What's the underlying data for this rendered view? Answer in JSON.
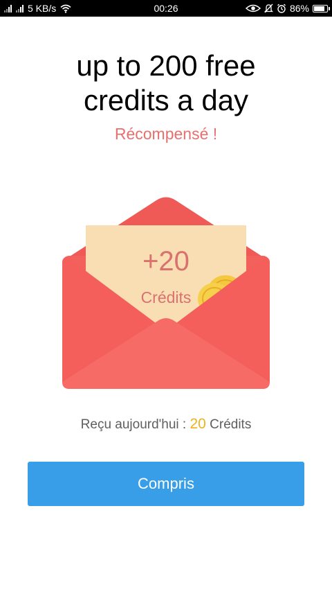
{
  "status_bar": {
    "speed": "5 KB/s",
    "time": "00:26",
    "battery": "86%",
    "battery_level": 0.86
  },
  "headline": {
    "line1": "up to 200 free",
    "line2": "credits a day"
  },
  "subtitle": "Récompensé !",
  "card": {
    "amount": "+20",
    "unit": "Crédits"
  },
  "received": {
    "label": "Reçu aujourd'hui :",
    "value": "20",
    "unit": "Crédits"
  },
  "button": {
    "label": "Compris"
  },
  "colors": {
    "accent_button": "#389ee8",
    "envelope": "#f2615c",
    "subtitle": "#e5706e",
    "highlight_number": "#f2b01e"
  }
}
